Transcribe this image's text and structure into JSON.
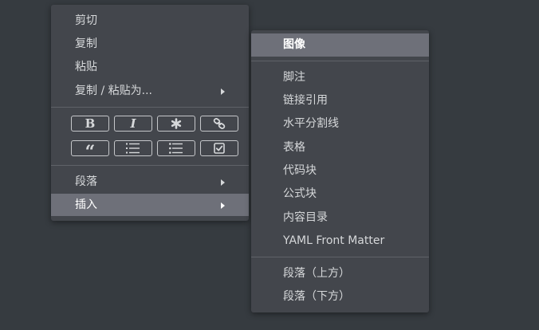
{
  "main_menu": {
    "cut": "剪切",
    "copy": "复制",
    "paste": "粘贴",
    "copy_paste_as": "复制 / 粘贴为...",
    "paragraph": "段落",
    "insert": "插入"
  },
  "format_toolbar": {
    "bold": "B",
    "italic": "I",
    "quote": "“",
    "icons": [
      "bold-icon",
      "italic-icon",
      "highlight-asterisk-icon",
      "link-icon",
      "quote-icon",
      "ordered-list-icon",
      "unordered-list-icon",
      "task-list-icon"
    ]
  },
  "insert_submenu": {
    "items": [
      "图像",
      "脚注",
      "链接引用",
      "水平分割线",
      "表格",
      "代码块",
      "公式块",
      "内容目录",
      "YAML Front Matter",
      "段落（上方）",
      "段落（下方）"
    ]
  },
  "colors": {
    "background": "#363b40",
    "menu": "#43464c",
    "highlight": "#6e7079",
    "text": "#d6d8da"
  }
}
